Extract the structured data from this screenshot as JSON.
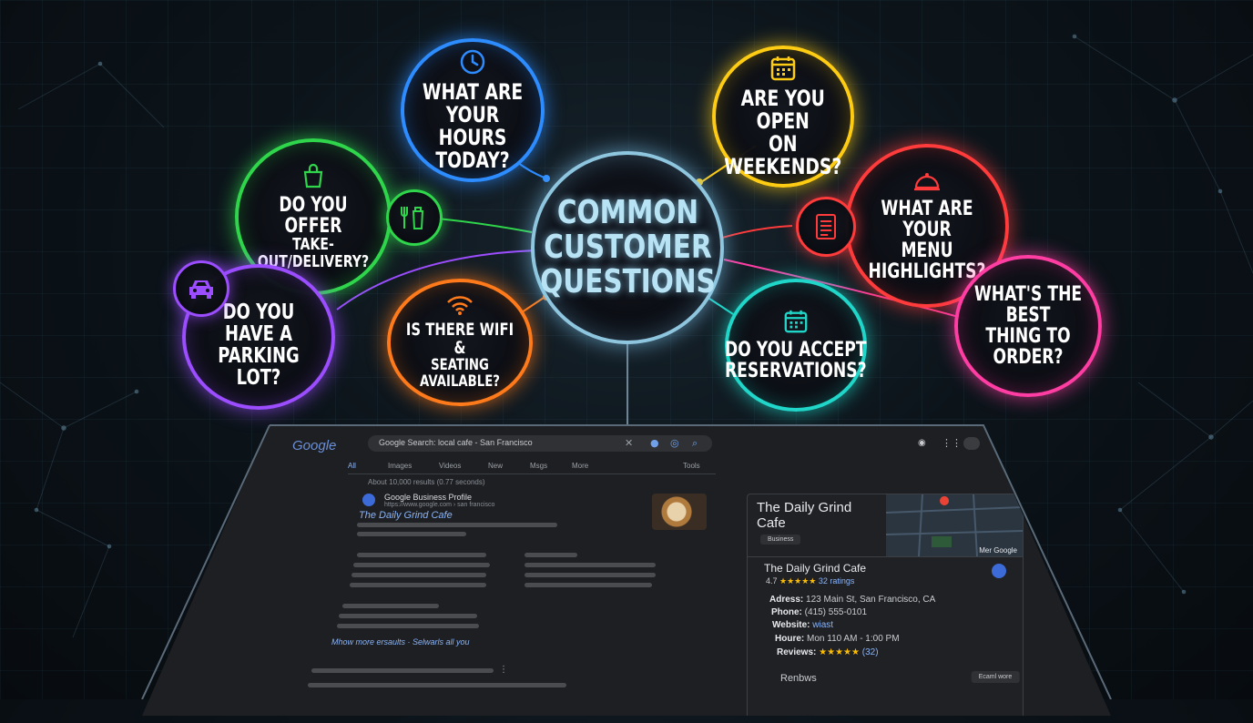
{
  "colors": {
    "center": "#8fc6df",
    "hours": "#2d8cff",
    "weekends": "#ffcc14",
    "takeout": "#2fd64b",
    "menu": "#ff3b3b",
    "parking": "#9b4dff",
    "wifi": "#ff7a1a",
    "reservations": "#1fd6c8",
    "best": "#ff3da3"
  },
  "center": {
    "line1": "Common",
    "line2": "Customer",
    "line3": "Questions"
  },
  "bubbles": {
    "hours": {
      "icon": "clock-icon",
      "line1": "What are",
      "line2": "your hours",
      "line3": "today?"
    },
    "weekends": {
      "icon": "calendar-icon",
      "line1": "Are you open",
      "line2": "on weekends?"
    },
    "takeout": {
      "icon": "shopping-bag-icon",
      "line1": "Do you offer",
      "line2": "take-out/delivery?",
      "badge_icon": "utensils-icon"
    },
    "menu": {
      "icon": "menu-document-icon",
      "badge_icon": "cloche-icon",
      "line1": "What are your",
      "line2": "menu highlights?"
    },
    "parking": {
      "icon": "car-icon",
      "line1": "Do you have a",
      "line2": "parking lot?"
    },
    "wifi": {
      "icon": "wifi-icon",
      "line1": "Is there WiFi &",
      "line2": "seating available?"
    },
    "reservations": {
      "icon": "calendar-icon",
      "line1": "Do you accept",
      "line2": "reservations?"
    },
    "best": {
      "line1": "What's the best",
      "line2": "thing to order?"
    }
  },
  "browser": {
    "logo": "Google",
    "search_query": "Google Search: local cafe - San Francisco",
    "tabs": [
      "All",
      "Images",
      "Videos",
      "New",
      "Msgs",
      "More"
    ],
    "tools": "Tools",
    "results_stats": "About 10,000 results (0.77 seconds)",
    "result": {
      "source": "Google Business Profile",
      "url": "https://www.google.com › san francisco",
      "title": "The Daily Grind Cafe"
    },
    "more_link": "Mhow more ersaults · Selwarls all you",
    "panel": {
      "title": "The Daily Grind Cafe",
      "badge": "Business",
      "map_label": "Mer Google",
      "name": "The Daily Grind Cafe",
      "rating": "4.7",
      "stars": "★★★★★",
      "ratings_count": "32 ratings",
      "address_label": "Adress:",
      "address": "123 Main St, San Francisco, CA",
      "phone_label": "Phone:",
      "phone": "(415) 555-0101",
      "website_label": "Website:",
      "website": "wiast",
      "hours_label": "Houre:",
      "hours": "Mon 110 AM - 1:00 PM",
      "reviews_label": "Reviews:",
      "reviews_stars": "★★★★★",
      "reviews_count": "(32)",
      "reviews_heading": "Renbws",
      "button": "Ecaml wore"
    }
  }
}
